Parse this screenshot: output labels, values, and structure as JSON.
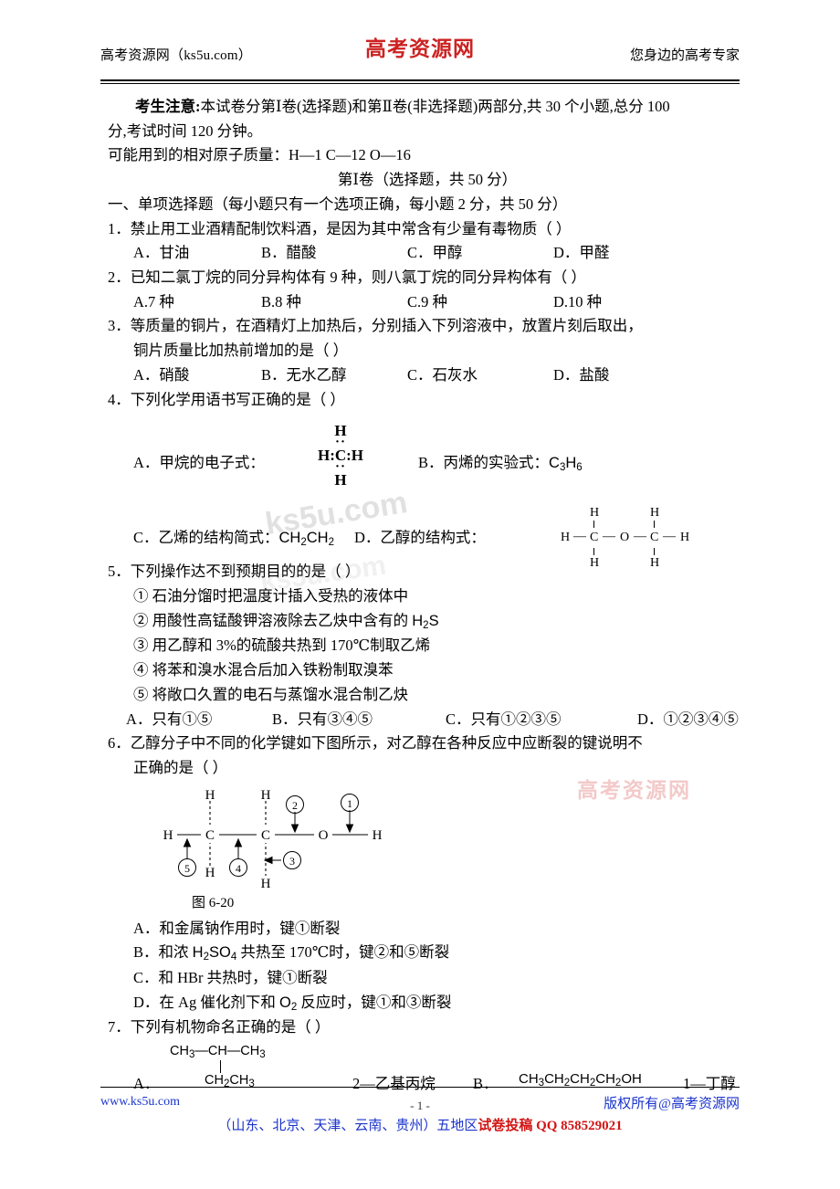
{
  "header": {
    "left": "高考资源网（ks5u.com）",
    "logo": "高考资源网",
    "right": "您身边的高考专家"
  },
  "notice": {
    "label": "考生注意:",
    "text": "本试卷分第Ⅰ卷(选择题)和第Ⅱ卷(非选择题)两部分,共 30 个小题,总分 100",
    "text_line2": "分,考试时间 120 分钟。",
    "atomic_mass": "可能用到的相对原子质量：H—1    C—12   O—16"
  },
  "section": {
    "paper_one": "第Ⅰ卷（选择题，共 50 分）",
    "part_one": "一、单项选择题（每小题只有一个选项正确，每小题 2 分，共 50 分）"
  },
  "questions": [
    {
      "number": "1．",
      "stem": "禁止用工业酒精配制饮料酒，是因为其中常含有少量有毒物质（     ）",
      "options": [
        "A．甘油",
        "B．醋酸",
        "C．甲醇",
        "D．甲醛"
      ],
      "option_x": [
        0,
        140,
        300,
        460
      ]
    },
    {
      "number": "2．",
      "stem": "已知二氯丁烷的同分异构体有 9 种，则八氯丁烷的同分异构体有（     ）",
      "options": [
        "A.7 种",
        "B.8 种",
        "C.9 种",
        "D.10 种"
      ],
      "option_x": [
        0,
        140,
        300,
        460
      ]
    },
    {
      "number": "3．",
      "stem": "等质量的铜片，在酒精灯上加热后，分别插入下列溶液中，放置片刻后取出，",
      "stem2": "铜片质量比加热前增加的是（     ）",
      "options": [
        "A．硝酸",
        "B．无水乙醇",
        "C．石灰水",
        "D．盐酸"
      ],
      "option_x": [
        0,
        140,
        300,
        460
      ]
    },
    {
      "number": "4．",
      "stem": "下列化学用语书写正确的是（     ）",
      "optA_label": "A．甲烷的电子式：",
      "lewis": {
        "top": "H",
        "dots_upper": "··",
        "mid_left": "H:",
        "mid_center": "C",
        "mid_right": ":H",
        "dots_lower": "··",
        "bottom": "H"
      },
      "optB_label": "B．丙烯的实验式：",
      "optB_formula": "C3H6",
      "optC_label": "C．乙烯的结构简式：",
      "optC_formula": "CH2CH2",
      "optD_label": "D．乙醇的结构式：",
      "ether": {
        "left_h": "H",
        "c1": "C",
        "o": "O",
        "c2": "C",
        "right_h": "H",
        "top_h1": "H",
        "top_h2": "H",
        "bot_h1": "H",
        "bot_h2": "H"
      }
    },
    {
      "number": "5．",
      "stem": "下列操作达不到预期目的的是（     ）",
      "items": [
        "① 石油分馏时把温度计插入受热的液体中",
        "② 用酸性高锰酸钾溶液除去乙炔中含有的 H2S",
        "③ 用乙醇和 3%的硫酸共热到 170℃制取乙烯",
        "④ 将苯和溴水混合后加入铁粉制取溴苯",
        "⑤ 将敞口久置的电石与蒸馏水混合制乙炔"
      ],
      "options": [
        "A．只有①⑤",
        "B．只有③④⑤",
        "C．只有①②③⑤",
        "D．①②③④⑤"
      ],
      "option_x": [
        0,
        160,
        350,
        560
      ]
    },
    {
      "number": "6．",
      "stem": "乙醇分子中不同的化学键如下图所示，对乙醇在各种反应中应断裂的键说明不",
      "stem2": "正确的是（    ）",
      "figure_caption": "图 6-20",
      "figure_atoms": {
        "h_left": "H",
        "c1": "C",
        "c2": "C",
        "o": "O",
        "h_right": "H",
        "h_top1": "H",
        "h_top2": "H",
        "h_bot1": "H",
        "h_bot2": "H",
        "n1": "①",
        "n2": "②",
        "n3": "③",
        "n4": "④",
        "n5": "⑤"
      },
      "options_stack": [
        "A．和金属钠作用时，键①断裂",
        "B．和浓 H2SO4 共热至 170℃时，键②和⑤断裂",
        "C．和 HBr 共热时，键①断裂",
        "D．在 Ag 催化剂下和 O2 反应时，键①和③断裂"
      ]
    },
    {
      "number": "7．",
      "stem": "下列有机物命名正确的是（    ）",
      "optA_label": "A．",
      "structA_top": "CH3—CH—CH3",
      "structA_bot": "CH2CH3",
      "nameA": "2—乙基丙烷",
      "optB_label": "B．",
      "formulaB": "CH3CH2CH2CH2OH",
      "nameB": "1—丁醇"
    }
  ],
  "footer": {
    "left": "www.ks5u.com",
    "page": "- 1 -",
    "right": "版权所有@高考资源网",
    "line2_blue": "（山东、北京、天津、云南、贵州）五地区",
    "line2_red": "试卷投稿 QQ 858529021"
  },
  "watermarks": {
    "gray": "ks5u.com",
    "pink": "高考资源网"
  }
}
